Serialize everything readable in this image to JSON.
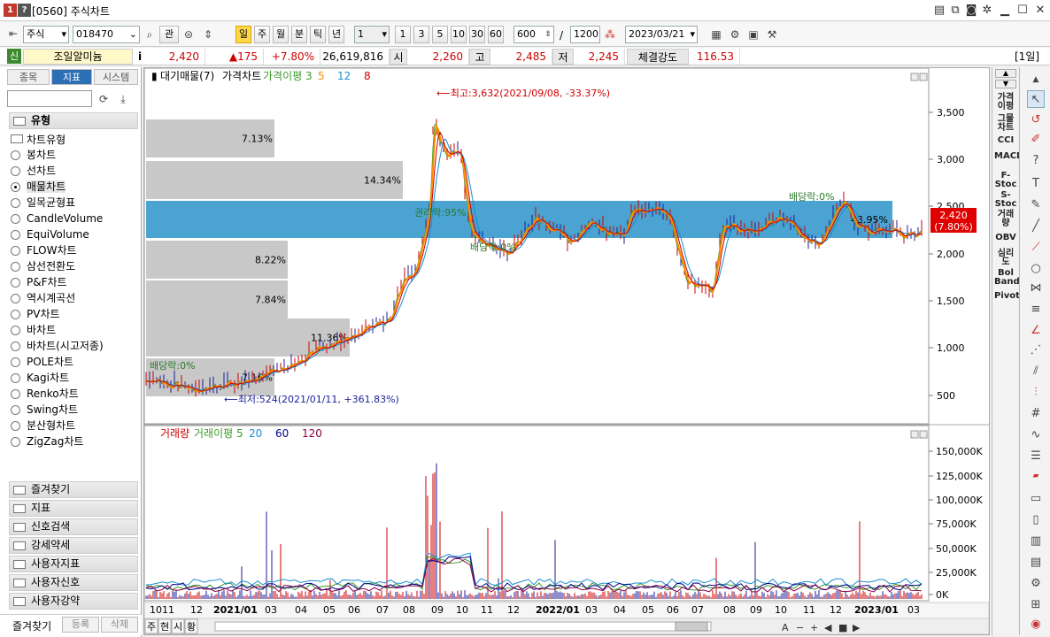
{
  "window": {
    "badge1": "1",
    "badge2": "?",
    "title": "[0560] 주식차트"
  },
  "toolbar": {
    "market": "주식",
    "code": "018470",
    "btn_gwan": "관",
    "periods": [
      "일",
      "주",
      "월",
      "분",
      "틱",
      "년"
    ],
    "selected_period": "일",
    "interval": "1",
    "quick_intervals": [
      "1",
      "3",
      "5",
      "10",
      "30",
      "60"
    ],
    "count": "600",
    "slash": "/",
    "max_count": "1200",
    "date": "2023/03/21"
  },
  "quote": {
    "badge": "신",
    "name": "조일알미늄",
    "info": "i",
    "price": "2,420",
    "change": "▲175",
    "pct": "+7.80%",
    "volume": "26,619,816",
    "open_label": "시",
    "open": "2,260",
    "high_label": "고",
    "high": "2,485",
    "low_label": "저",
    "low": "2,245",
    "strength_label": "체결강도",
    "strength": "116.53",
    "period_tag": "[1일]"
  },
  "leftpanel": {
    "tabs": [
      "종목",
      "지표",
      "시스템"
    ],
    "selected_tab": "지표",
    "root": "유형",
    "group": "차트유형",
    "items": [
      "봉차트",
      "선차트",
      "매물차트",
      "일목균형표",
      "CandleVolume",
      "EquiVolume",
      "FLOW차트",
      "삼선전환도",
      "P&F차트",
      "역시계곡선",
      "PV차트",
      "바차트",
      "바차트(시고저종)",
      "POLE차트",
      "Kagi차트",
      "Renko차트",
      "Swing차트",
      "분산형차트",
      "ZigZag차트"
    ],
    "selected_item": "매물차트",
    "folders": [
      "즐겨찾기",
      "지표",
      "신호검색",
      "강세약세",
      "사용자지표",
      "사용자신호",
      "사용자강약"
    ],
    "bottom": [
      "즐겨찾기",
      "등록",
      "삭제"
    ]
  },
  "price_panel": {
    "legend": [
      {
        "text": "대기매물(7)",
        "color": "#000000"
      },
      {
        "text": "가격차트",
        "color": "#000000"
      },
      {
        "text": "가격이평 3",
        "color": "#3a9a2a"
      },
      {
        "text": "5",
        "color": "#ff8c00"
      },
      {
        "text": "12",
        "color": "#1a8fd0"
      },
      {
        "text": "8",
        "color": "#cc0000"
      }
    ],
    "y_ticks": [
      "3,500",
      "3,000",
      "2,500",
      "2,000",
      "1,500",
      "1,000",
      "500"
    ],
    "last_price": "2,420",
    "last_pct": "(7.80%)",
    "high_note": "최고:3,632(2021/09/08, -33.37%)",
    "low_note": "최저:524(2021/01/11, +361.83%)",
    "annot_rights": "권리락:95%",
    "annot_div_left": "배당락:0%",
    "annot_div_mid": "배당락:0%",
    "annot_div_right": "배당락:0%",
    "volume_profile": [
      "7.13%",
      "14.34%",
      "43.95%",
      "8.22%",
      "7.84%",
      "11.36%",
      "7.16%"
    ]
  },
  "volume_panel": {
    "legend": [
      {
        "text": "거래량",
        "color": "#cc0000"
      },
      {
        "text": "거래이평 5",
        "color": "#3a9a2a"
      },
      {
        "text": "20",
        "color": "#1a8fd0"
      },
      {
        "text": "60",
        "color": "#00008b"
      },
      {
        "text": "120",
        "color": "#8b0045"
      }
    ],
    "y_ticks": [
      "150,000K",
      "125,000K",
      "100,000K",
      "75,000K",
      "50,000K",
      "25,000K",
      "0K"
    ]
  },
  "x_axis": [
    "10",
    "11",
    "12",
    "2021/01",
    "03",
    "04",
    "05",
    "06",
    "07",
    "08",
    "09",
    "10",
    "11",
    "12",
    "2022/01",
    "03",
    "04",
    "05",
    "06",
    "07",
    "08",
    "09",
    "10",
    "11",
    "12",
    "2023/01",
    "03"
  ],
  "bottombar": {
    "tabs": [
      "주",
      "현",
      "시",
      "황"
    ]
  },
  "rightbar": [
    "가격이평",
    "그물차트",
    "CCI",
    "MACD",
    "F-Stoc",
    "S-Stoc",
    "거래량",
    "OBV",
    "심리도",
    "Bol Band",
    "Pivot"
  ],
  "colors": {
    "accent": "#2d6fb5",
    "up": "#cc0000",
    "band": "#4aa3d0",
    "profile": "#c8c8c8"
  }
}
